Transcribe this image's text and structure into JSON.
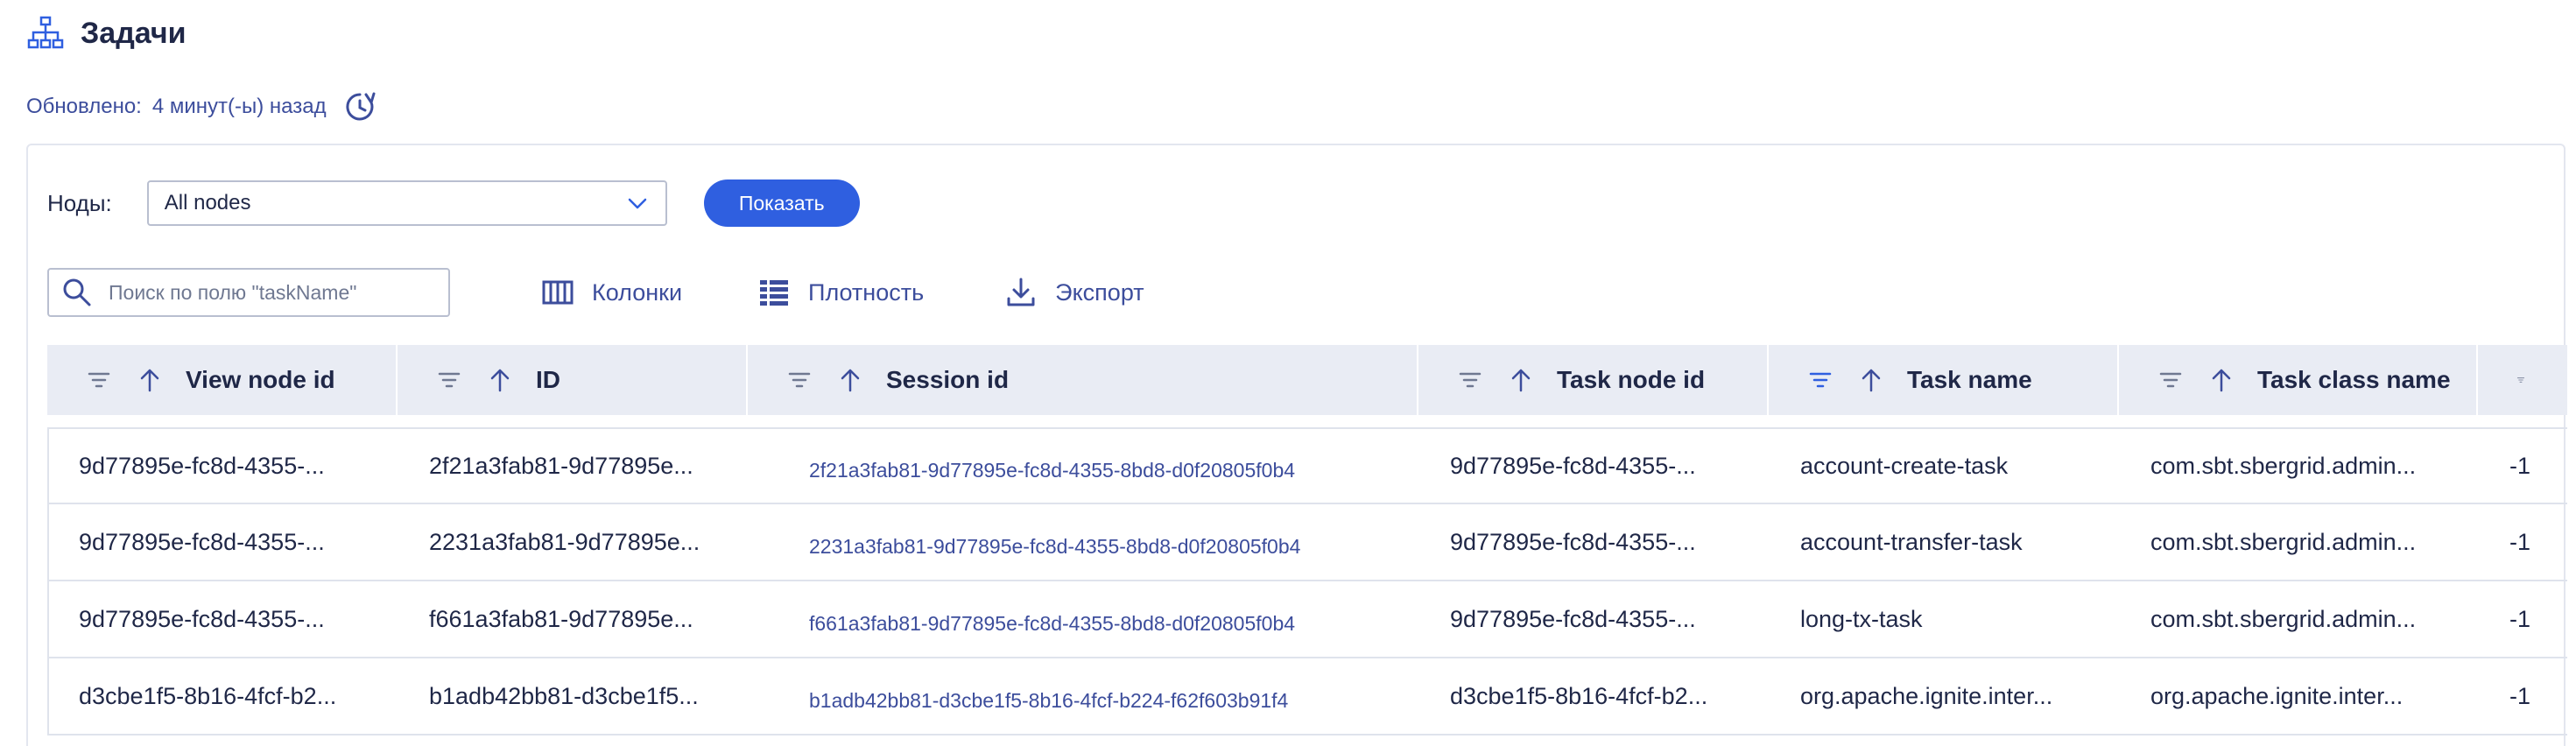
{
  "header": {
    "title": "Задачи",
    "icon": "sitemap-icon"
  },
  "updated": {
    "label": "Обновлено:",
    "value": "4 минут(-ы) назад",
    "icon": "refresh-clock-icon"
  },
  "filters": {
    "nodes_label": "Ноды:",
    "nodes_value": "All nodes",
    "show_button": "Показать"
  },
  "toolbar": {
    "search_placeholder": "Поиск по полю \"taskName\"",
    "columns_label": "Колонки",
    "density_label": "Плотность",
    "export_label": "Экспорт"
  },
  "table": {
    "columns": [
      "View node id",
      "ID",
      "Session id",
      "Task node id",
      "Task name",
      "Task class name"
    ],
    "rows": [
      [
        "9d77895e-fc8d-4355-...",
        "2f21a3fab81-9d77895e...",
        "2f21a3fab81-9d77895e-fc8d-4355-8bd8-d0f20805f0b4",
        "9d77895e-fc8d-4355-...",
        "account-create-task",
        "com.sbt.sbergrid.admin...",
        "-1"
      ],
      [
        "9d77895e-fc8d-4355-...",
        "2231a3fab81-9d77895e...",
        "2231a3fab81-9d77895e-fc8d-4355-8bd8-d0f20805f0b4",
        "9d77895e-fc8d-4355-...",
        "account-transfer-task",
        "com.sbt.sbergrid.admin...",
        "-1"
      ],
      [
        "9d77895e-fc8d-4355-...",
        "f661a3fab81-9d77895e...",
        "f661a3fab81-9d77895e-fc8d-4355-8bd8-d0f20805f0b4",
        "9d77895e-fc8d-4355-...",
        "long-tx-task",
        "com.sbt.sbergrid.admin...",
        "-1"
      ],
      [
        "d3cbe1f5-8b16-4fcf-b2...",
        "b1adb42bb81-d3cbe1f5...",
        "b1adb42bb81-d3cbe1f5-8b16-4fcf-b224-f62f603b91f4",
        "d3cbe1f5-8b16-4fcf-b2...",
        "org.apache.ignite.inter...",
        "org.apache.ignite.inter...",
        "-1"
      ]
    ]
  },
  "colors": {
    "primary": "#2f5fe0",
    "text": "#1f2747",
    "link": "#3c4d9c",
    "header_bg": "#e9ecf4"
  }
}
